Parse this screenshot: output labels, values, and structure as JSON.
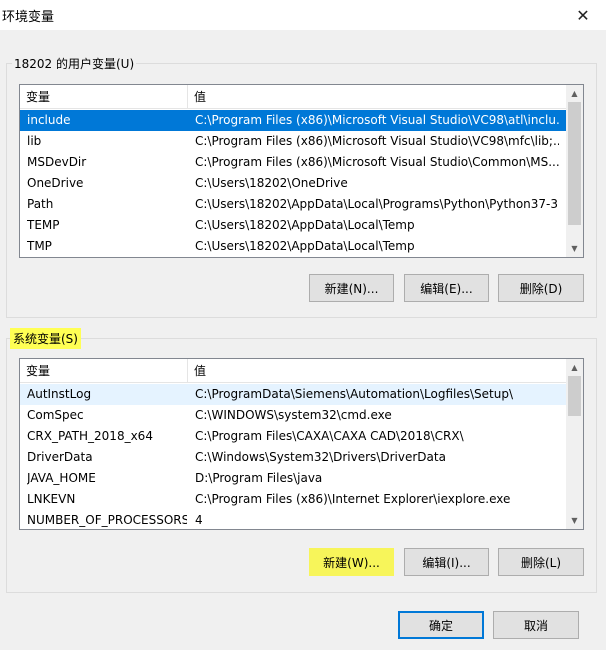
{
  "window": {
    "title": "环境变量",
    "close_glyph": "✕"
  },
  "user_vars": {
    "group_label": "18202 的用户变量(U)",
    "columns": [
      "变量",
      "值"
    ],
    "rows": [
      {
        "name": "include",
        "value": "C:\\Program Files (x86)\\Microsoft Visual Studio\\VC98\\atl\\inclu...",
        "selected": true
      },
      {
        "name": "lib",
        "value": "C:\\Program Files (x86)\\Microsoft Visual Studio\\VC98\\mfc\\lib;..."
      },
      {
        "name": "MSDevDir",
        "value": "C:\\Program Files (x86)\\Microsoft Visual Studio\\Common\\MS..."
      },
      {
        "name": "OneDrive",
        "value": "C:\\Users\\18202\\OneDrive"
      },
      {
        "name": "Path",
        "value": "C:\\Users\\18202\\AppData\\Local\\Programs\\Python\\Python37-3..."
      },
      {
        "name": "TEMP",
        "value": "C:\\Users\\18202\\AppData\\Local\\Temp"
      },
      {
        "name": "TMP",
        "value": "C:\\Users\\18202\\AppData\\Local\\Temp"
      }
    ],
    "buttons": {
      "new": "新建(N)...",
      "edit": "编辑(E)...",
      "delete": "删除(D)"
    }
  },
  "system_vars": {
    "group_label": "系统变量(S)",
    "columns": [
      "变量",
      "值"
    ],
    "rows": [
      {
        "name": "AutInstLog",
        "value": "C:\\ProgramData\\Siemens\\Automation\\Logfiles\\Setup\\",
        "hover": true
      },
      {
        "name": "ComSpec",
        "value": "C:\\WINDOWS\\system32\\cmd.exe"
      },
      {
        "name": "CRX_PATH_2018_x64",
        "value": "C:\\Program Files\\CAXA\\CAXA CAD\\2018\\CRX\\"
      },
      {
        "name": "DriverData",
        "value": "C:\\Windows\\System32\\Drivers\\DriverData"
      },
      {
        "name": "JAVA_HOME",
        "value": "D:\\Program Files\\java"
      },
      {
        "name": "LNKEVN",
        "value": "C:\\Program Files (x86)\\Internet Explorer\\iexplore.exe"
      },
      {
        "name": "NUMBER_OF_PROCESSORS",
        "value": "4"
      }
    ],
    "buttons": {
      "new": "新建(W)...",
      "edit": "编辑(I)...",
      "delete": "删除(L)"
    }
  },
  "footer": {
    "ok": "确定",
    "cancel": "取消"
  },
  "icons": {
    "scroll_up": "▲",
    "scroll_down": "▼"
  },
  "colors": {
    "selection": "#0078d7",
    "highlight": "#ffff54",
    "default_button_border": "#0078d7"
  }
}
